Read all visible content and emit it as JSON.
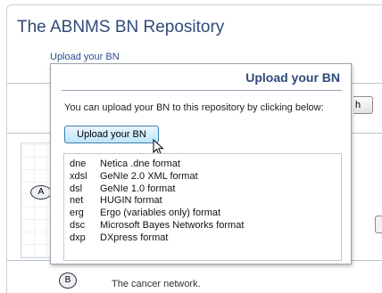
{
  "site": {
    "title": "The ABNMS BN Repository",
    "upload_link": "Upload your BN",
    "search_button_fragment": "h"
  },
  "background": {
    "nodes": [
      "A",
      "B"
    ],
    "network_description": "The cancer network."
  },
  "popup": {
    "title": "Upload your BN",
    "description": "You can upload your BN to this repository by clicking below:",
    "button_label": "Upload your BN",
    "formats": [
      {
        "ext": "dne",
        "desc": "Netica .dne format"
      },
      {
        "ext": "xdsl",
        "desc": "GeNIe 2.0 XML format"
      },
      {
        "ext": "dsl",
        "desc": "GeNIe 1.0 format"
      },
      {
        "ext": "net",
        "desc": "HUGIN format"
      },
      {
        "ext": "erg",
        "desc": "Ergo (variables only) format"
      },
      {
        "ext": "dsc",
        "desc": "Microsoft Bayes Networks format"
      },
      {
        "ext": "dxp",
        "desc": "DXpress format"
      }
    ]
  },
  "colors": {
    "title": "#2f4a7a",
    "link": "#2b4d8c",
    "button_border": "#3c7fb1"
  },
  "icons": {
    "cursor": "mouse-pointer-icon"
  }
}
